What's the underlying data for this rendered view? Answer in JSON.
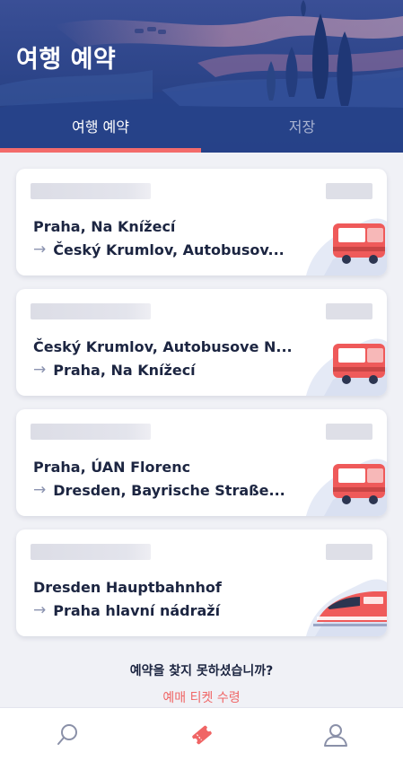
{
  "header": {
    "title": "여행 예약",
    "tabs": [
      {
        "label": "여행 예약",
        "active": true
      },
      {
        "label": "저장",
        "active": false
      }
    ]
  },
  "bookings": [
    {
      "from": "Praha, Na Knížecí",
      "to": "Český Krumlov, Autobusov...",
      "vehicle": "bus-icon"
    },
    {
      "from": "Český Krumlov, Autobusove N...",
      "to": "Praha, Na Knížecí",
      "vehicle": "bus-icon"
    },
    {
      "from": "Praha, ÚAN Florenc",
      "to": "Dresden, Bayrische Straße...",
      "vehicle": "bus-icon"
    },
    {
      "from": "Dresden Hauptbahnhof",
      "to": "Praha hlavní nádraží",
      "vehicle": "train-icon"
    }
  ],
  "footer": {
    "not_found": "예약을 찾지 못하셨습니까?",
    "claim_link": "예매 티켓 수령"
  },
  "bottom_nav": {
    "items": [
      "search-icon",
      "tickets-icon",
      "profile-icon"
    ],
    "active": "tickets-icon"
  },
  "colors": {
    "header_bg": "#223e80",
    "accent": "#f36b6b",
    "text_dark": "#1c2541",
    "background": "#f0f1f6"
  }
}
